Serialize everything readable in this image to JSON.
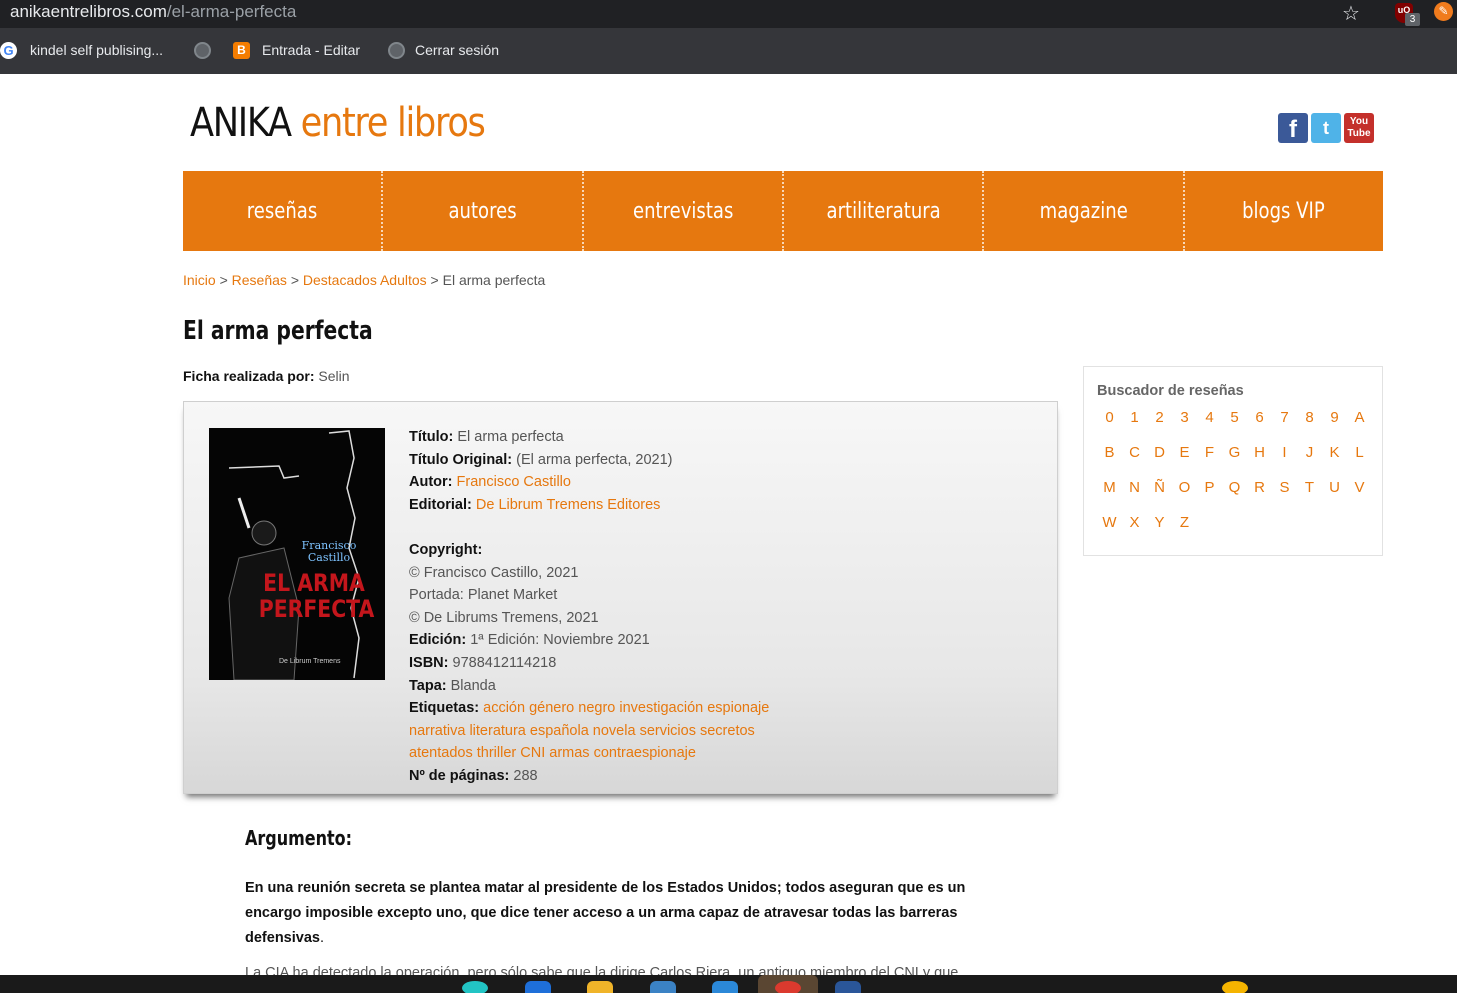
{
  "browser": {
    "url_domain": "anikaentrelibros.com",
    "url_path": "/el-arma-perfecta",
    "extension_badge": "3",
    "bookmarks": [
      "kindel self publising...",
      "Entrada - Editar",
      "Cerrar sesión"
    ]
  },
  "site": {
    "logo_part1": "ANIKA",
    "logo_part2": "entre libros",
    "accent_color": "#e6780f"
  },
  "nav": [
    "reseñas",
    "autores",
    "entrevistas",
    "artiliteratura",
    "magazine",
    "blogs VIP"
  ],
  "breadcrumb": {
    "inicio": "Inicio",
    "resenas": "Reseñas",
    "destacados": "Destacados Adultos",
    "current": "El arma perfecta",
    "sep": ">"
  },
  "page_title": "El arma perfecta",
  "ficha": {
    "label": "Ficha realizada por:",
    "value": "Selin"
  },
  "cover": {
    "author": "Francisco Castillo",
    "title": "EL ARMA PERFECTA",
    "publisher": "De Librum Tremens"
  },
  "book": {
    "titulo_label": "Título:",
    "titulo": "El arma perfecta",
    "original_label": "Título Original:",
    "original": "(El arma perfecta, 2021)",
    "autor_label": "Autor:",
    "autor": "Francisco Castillo",
    "editorial_label": "Editorial:",
    "editorial": "De Librum Tremens Editores",
    "copyright_label": "Copyright:",
    "copyright_lines": [
      "© Francisco Castillo, 2021",
      "Portada: Planet Market",
      "© De Librums Tremens, 2021"
    ],
    "edicion_label": "Edición:",
    "edicion": "1ª Edición: Noviembre 2021",
    "isbn_label": "ISBN:",
    "isbn": "9788412114218",
    "tapa_label": "Tapa:",
    "tapa": "Blanda",
    "etiquetas_label": "Etiquetas:",
    "tags": [
      "acción",
      "género negro",
      "investigación",
      "espionaje",
      "narrativa",
      "literatura española",
      "novela",
      "servicios secretos",
      "atentados",
      "thriller",
      "CNI",
      "armas",
      "contraespionaje"
    ],
    "paginas_label": "Nº de páginas:",
    "paginas": "288"
  },
  "sidebar": {
    "title": "Buscador de reseñas",
    "letters": [
      "0",
      "1",
      "2",
      "3",
      "4",
      "5",
      "6",
      "7",
      "8",
      "9",
      "A",
      "B",
      "C",
      "D",
      "E",
      "F",
      "G",
      "H",
      "I",
      "J",
      "K",
      "L",
      "M",
      "N",
      "Ñ",
      "O",
      "P",
      "Q",
      "R",
      "S",
      "T",
      "U",
      "V",
      "W",
      "X",
      "Y",
      "Z"
    ]
  },
  "argumento": {
    "title": "Argumento:",
    "text": "En una reunión secreta se plantea matar al presidente de los Estados Unidos; todos aseguran que es un encargo imposible excepto uno, que dice tener acceso a un arma capaz de atravesar todas las barreras defensivas",
    "end": ".",
    "next_line": "La CIA ha detectado la operación, pero sólo sabe que la dirige Carlos Riera, un antiguo miembro del CNI y que"
  }
}
